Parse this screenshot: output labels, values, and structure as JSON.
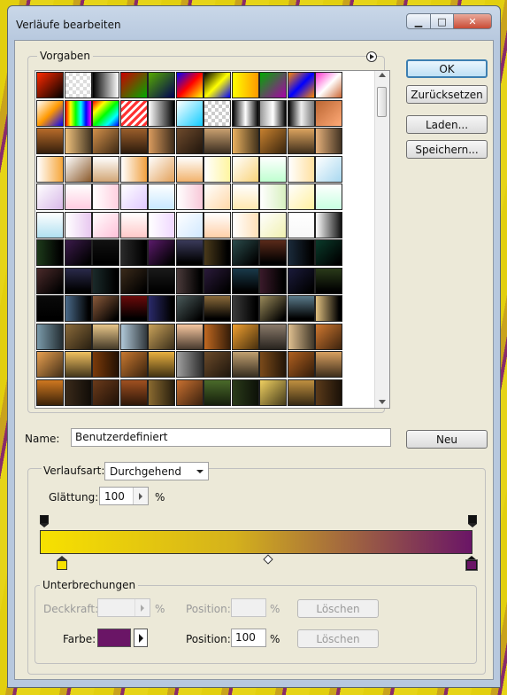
{
  "window": {
    "title": "Verläufe bearbeiten",
    "caption_buttons": {
      "minimize": "▁",
      "maximize": "□",
      "close": "✕"
    }
  },
  "presets": {
    "group_label": "Vorgaben",
    "menu_icon": "circle-arrow-right-icon"
  },
  "buttons": {
    "ok": "OK",
    "reset": "Zurücksetzen",
    "load": "Laden...",
    "save": "Speichern...",
    "new": "Neu"
  },
  "name_field": {
    "label": "Name:",
    "value": "Benutzerdefiniert"
  },
  "gradient_type": {
    "label": "Verlaufsart:",
    "value": "Durchgehend"
  },
  "smoothness": {
    "label": "Glättung:",
    "value": "100",
    "unit": "%"
  },
  "gradient_bar": {
    "start_color": "#f7e100",
    "mid_color": "#d4b11c",
    "end_color": "#6a1566"
  },
  "stops": {
    "group_label": "Unterbrechungen",
    "opacity_label": "Deckkraft:",
    "opacity_value": "",
    "opacity_unit": "%",
    "opacity_position_label": "Position:",
    "opacity_position_value": "",
    "opacity_position_unit": "%",
    "opacity_delete": "Löschen",
    "color_label": "Farbe:",
    "color_value": "#6a1566",
    "color_position_label": "Position:",
    "color_position_value": "100",
    "color_position_unit": "%",
    "color_delete": "Löschen"
  }
}
